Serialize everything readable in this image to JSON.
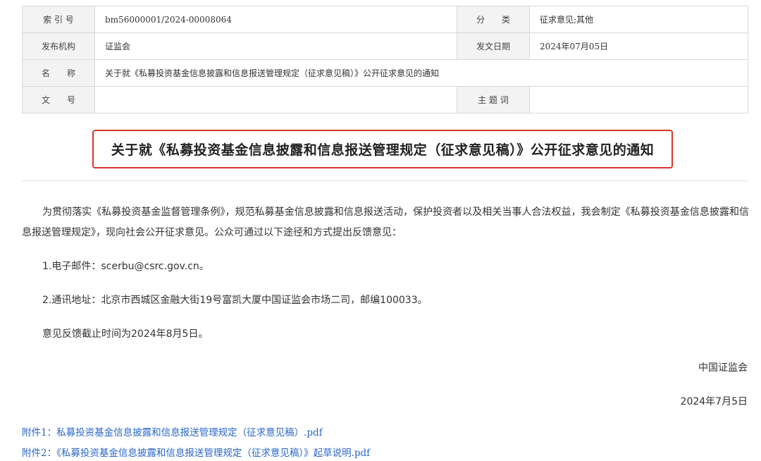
{
  "meta": {
    "index_label": "索 引 号",
    "index_value": "bm56000001/2024-00008064",
    "category_label": "分　　类",
    "category_value": "征求意见;其他",
    "issuer_label": "发布机构",
    "issuer_value": "证监会",
    "date_label": "发文日期",
    "date_value": "2024年07月05日",
    "name_label": "名　　称",
    "name_value": "关于就《私募投资基金信息披露和信息报送管理规定（征求意见稿）》公开征求意见的通知",
    "doc_no_label": "文　　号",
    "doc_no_value": "",
    "keywords_label": "主 题 词",
    "keywords_value": ""
  },
  "article": {
    "title": "关于就《私募投资基金信息披露和信息报送管理规定（征求意见稿）》公开征求意见的通知",
    "para1": "为贯彻落实《私募投资基金监督管理条例》，规范私募基金信息披露和信息报送活动，保护投资者以及相关当事人合法权益，我会制定《私募投资基金信息披露和信息报送管理规定》，现向社会公开征求意见。公众可通过以下途径和方式提出反馈意见：",
    "item1": "1.电子邮件：scerbu@csrc.gov.cn。",
    "item2": "2.通讯地址：北京市西城区金融大街19号富凯大厦中国证监会市场二司，邮编100033。",
    "deadline": "意见反馈截止时间为2024年8月5日。",
    "signature": "中国证监会",
    "sign_date": "2024年7月5日"
  },
  "attachments": [
    {
      "label": "附件1：",
      "name": "私募投资基金信息披露和信息报送管理规定（征求意见稿）.pdf"
    },
    {
      "label": "附件2：",
      "name": "《私募投资基金信息披露和信息报送管理规定（征求意见稿）》起草说明.pdf"
    }
  ],
  "colors": {
    "title_border": "#d9362b",
    "link": "#2a66c9",
    "label_bg": "#f3f3f3"
  }
}
